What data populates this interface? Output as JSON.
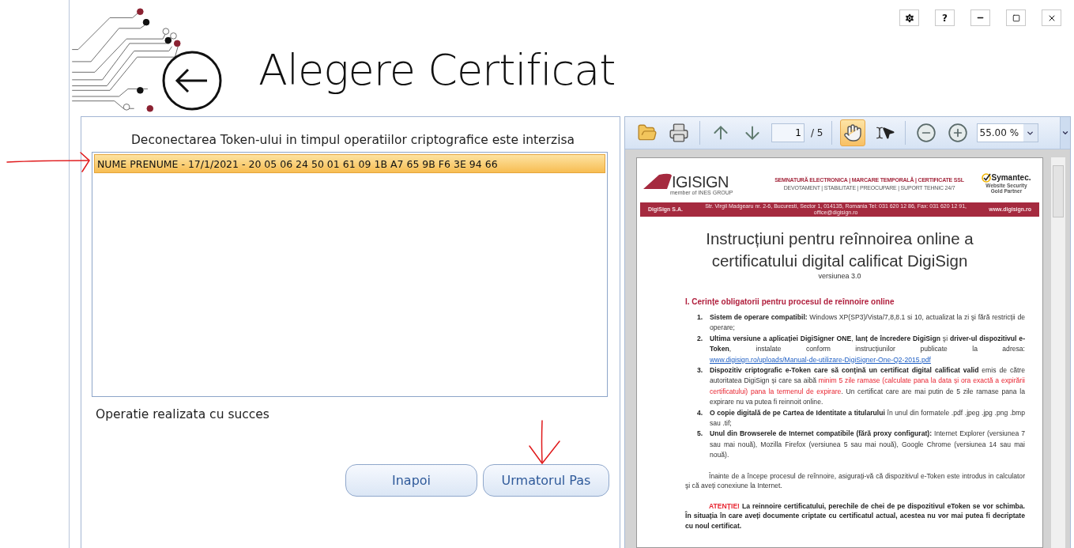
{
  "window_controls": [
    {
      "kind": "settings"
    },
    {
      "kind": "help",
      "label": "?"
    },
    {
      "kind": "minimize"
    },
    {
      "kind": "maximize"
    },
    {
      "kind": "close"
    }
  ],
  "header": {
    "title": "Alegere Certificat"
  },
  "certificate_panel": {
    "notice": "Deconectarea Token-ului in timpul operatiilor criptografice este interzisa",
    "certificates": [
      {
        "label": "NUME PRENUME - 17/1/2021 - 20 05 06 24 50 01 61 09 1B A7 65 9B F6 3E 94 66",
        "selected": true,
        "marked_with_arrow": true
      }
    ],
    "status": "Operatie realizata cu succes",
    "buttons": [
      {
        "label": "Inapoi",
        "marked_with_arrow": false
      },
      {
        "label": "Urmatorul Pas",
        "marked_with_arrow": true
      }
    ]
  },
  "viewer": {
    "page": "1",
    "page_total": "/ 5",
    "zoom": "55.00 %",
    "tools": [
      {
        "kind": "hand",
        "selected": true
      },
      {
        "kind": "select",
        "selected": false
      }
    ],
    "document": {
      "brand": "IGISIGN",
      "brand_tagline": "member of INES GROUP",
      "services": "SEMNATURĂ ELECTRONICA | MARCARE TEMPORALĂ | CERTIFICATE SSL",
      "values": "DEVOTAMENT | STABILITATE | PREOCUPARE | SUPORT TEHNIC 24/7",
      "partner": "Symantec.",
      "partner_lines": [
        "Website Security",
        "Gold Partner"
      ],
      "band": [
        "DigiSign S.A.",
        "Str. Virgil Madgearu nr. 2-6, Bucuresti, Sector 1, 014135, Romania Tel: 031 620 12 86, Fax: 031 620 12 91, office@digisign.ro",
        "www.digisign.ro"
      ],
      "title_lines": [
        "Instrucțiuni pentru reînnoirea online a",
        "certificatului digital calificat DigiSign"
      ],
      "version": "versiunea 3.0",
      "section": "I. Cerințe obligatorii pentru procesul de reînnoire online",
      "requirements": [
        {
          "number": "1.",
          "segments": [
            {
              "kind": "bold",
              "text": "Sistem de operare compatibil:"
            },
            {
              "kind": "plain",
              "text": " Windows XP(SP3)/Vista/7,8,8.1 si 10, actualizat la zi şi fără restricții de operare;"
            }
          ]
        },
        {
          "number": "2.",
          "segments": [
            {
              "kind": "bold",
              "text": "Ultima versiune a aplicației DigiSigner ONE"
            },
            {
              "kind": "plain",
              "text": ", "
            },
            {
              "kind": "bold",
              "text": "lanț de încredere DigiSign"
            },
            {
              "kind": "plain",
              "text": " şi "
            },
            {
              "kind": "bold",
              "text": "driver-ul dispozitivul e-Token"
            },
            {
              "kind": "plain",
              "text": ", instalate conform instrucțiunilor publicate la adresa: "
            },
            {
              "kind": "link",
              "text": "www.digisign.ro/uploads/Manual-de-utilizare-DigiSigner-One-Q2-2015.pdf"
            }
          ]
        },
        {
          "number": "3.",
          "segments": [
            {
              "kind": "bold",
              "text": "Dispozitiv criptografic e-Token care să conţină un certificat digital calificat valid"
            },
            {
              "kind": "plain",
              "text": " emis de către autoritatea DigiSign și care sa aibă "
            },
            {
              "kind": "red",
              "text": "minim 5 zile ramase (calculate pana la data și ora exactă a expirării certificatului) pana la termenul de expirare"
            },
            {
              "kind": "plain",
              "text": ". Un certificat care are mai putin de 5 zile ramase pana la expirare nu va putea fi reinnoit online."
            }
          ]
        },
        {
          "number": "4.",
          "segments": [
            {
              "kind": "bold",
              "text": "O copie digitală de pe Cartea de Identitate a titularului"
            },
            {
              "kind": "plain",
              "text": " în unul din formatele .pdf .jpeg .jpg .png .bmp sau .tif;"
            }
          ]
        },
        {
          "number": "5.",
          "segments": [
            {
              "kind": "bold",
              "text": "Unul din Browserele de Internet compatibile (fără proxy configurat):"
            },
            {
              "kind": "plain",
              "text": " Internet Explorer (versiunea 7 sau mai nouă), Mozilla Firefox (versiunea 5 sau mai nouă), Google Chrome (versiunea 14 sau mai nouă)."
            }
          ]
        }
      ],
      "paragraphs": [
        {
          "segments": [
            {
              "kind": "plain",
              "text": "Înainte de a începe procesul de reînnoire, asigurați-vă că dispozitivul e-Token este introdus in calculator şi că aveți conexiune la Internet."
            }
          ]
        },
        {
          "segments": [
            {
              "kind": "alert",
              "text": "ATENȚIE!"
            },
            {
              "kind": "bold",
              "text": " La reinnoire certificatului, perechile de chei de pe dispozitivul eToken se vor schimba. În situația în care aveți documente criptate cu certificatul actual, acestea nu vor mai putea fi decriptate cu noul certificat."
            }
          ]
        }
      ]
    }
  }
}
